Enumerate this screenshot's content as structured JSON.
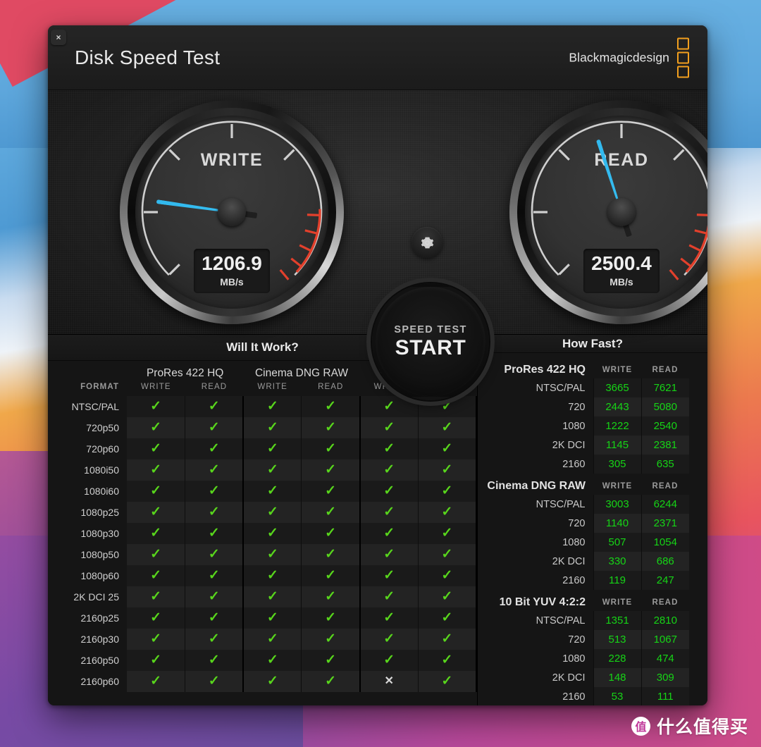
{
  "window": {
    "title": "Disk Speed Test",
    "close_label": "×",
    "brand": "Blackmagicdesign"
  },
  "gauges": {
    "write": {
      "label": "WRITE",
      "value": "1206.9",
      "unit": "MB/s",
      "needle_angle_deg": 188,
      "needle_color": "#33bbee"
    },
    "read": {
      "label": "READ",
      "value": "2500.4",
      "unit": "MB/s",
      "needle_angle_deg": 252,
      "needle_color": "#33bbee"
    }
  },
  "controls": {
    "gear_icon": "gear-icon",
    "start_sub": "SPEED TEST",
    "start_main": "START"
  },
  "will_it_work": {
    "heading": "Will It Work?",
    "format_label": "FORMAT",
    "groups": [
      "ProRes 422 HQ",
      "Cinema DNG RAW",
      "10 Bit YUV 4:2:2"
    ],
    "subheaders": [
      "WRITE",
      "READ"
    ],
    "ok_glyph": "✓",
    "no_glyph": "✕",
    "rows": [
      {
        "format": "NTSC/PAL",
        "cells": [
          true,
          true,
          true,
          true,
          true,
          true
        ]
      },
      {
        "format": "720p50",
        "cells": [
          true,
          true,
          true,
          true,
          true,
          true
        ]
      },
      {
        "format": "720p60",
        "cells": [
          true,
          true,
          true,
          true,
          true,
          true
        ]
      },
      {
        "format": "1080i50",
        "cells": [
          true,
          true,
          true,
          true,
          true,
          true
        ]
      },
      {
        "format": "1080i60",
        "cells": [
          true,
          true,
          true,
          true,
          true,
          true
        ]
      },
      {
        "format": "1080p25",
        "cells": [
          true,
          true,
          true,
          true,
          true,
          true
        ]
      },
      {
        "format": "1080p30",
        "cells": [
          true,
          true,
          true,
          true,
          true,
          true
        ]
      },
      {
        "format": "1080p50",
        "cells": [
          true,
          true,
          true,
          true,
          true,
          true
        ]
      },
      {
        "format": "1080p60",
        "cells": [
          true,
          true,
          true,
          true,
          true,
          true
        ]
      },
      {
        "format": "2K DCI 25",
        "cells": [
          true,
          true,
          true,
          true,
          true,
          true
        ]
      },
      {
        "format": "2160p25",
        "cells": [
          true,
          true,
          true,
          true,
          true,
          true
        ]
      },
      {
        "format": "2160p30",
        "cells": [
          true,
          true,
          true,
          true,
          true,
          true
        ]
      },
      {
        "format": "2160p50",
        "cells": [
          true,
          true,
          true,
          true,
          true,
          true
        ]
      },
      {
        "format": "2160p60",
        "cells": [
          true,
          true,
          true,
          true,
          false,
          true
        ]
      }
    ]
  },
  "how_fast": {
    "heading": "How Fast?",
    "col_write": "WRITE",
    "col_read": "READ",
    "sections": [
      {
        "name": "ProRes 422 HQ",
        "rows": [
          {
            "label": "NTSC/PAL",
            "write": "3665",
            "read": "7621"
          },
          {
            "label": "720",
            "write": "2443",
            "read": "5080"
          },
          {
            "label": "1080",
            "write": "1222",
            "read": "2540"
          },
          {
            "label": "2K DCI",
            "write": "1145",
            "read": "2381"
          },
          {
            "label": "2160",
            "write": "305",
            "read": "635"
          }
        ]
      },
      {
        "name": "Cinema DNG RAW",
        "rows": [
          {
            "label": "NTSC/PAL",
            "write": "3003",
            "read": "6244"
          },
          {
            "label": "720",
            "write": "1140",
            "read": "2371"
          },
          {
            "label": "1080",
            "write": "507",
            "read": "1054"
          },
          {
            "label": "2K DCI",
            "write": "330",
            "read": "686"
          },
          {
            "label": "2160",
            "write": "119",
            "read": "247"
          }
        ]
      },
      {
        "name": "10 Bit YUV 4:2:2",
        "rows": [
          {
            "label": "NTSC/PAL",
            "write": "1351",
            "read": "2810"
          },
          {
            "label": "720",
            "write": "513",
            "read": "1067"
          },
          {
            "label": "1080",
            "write": "228",
            "read": "474"
          },
          {
            "label": "2K DCI",
            "write": "148",
            "read": "309"
          },
          {
            "label": "2160",
            "write": "53",
            "read": "111"
          }
        ]
      }
    ]
  },
  "watermark": {
    "logo_char": "值",
    "text": "什么值得买"
  },
  "colors": {
    "accent_green": "#16d416",
    "check_green": "#58d51c",
    "needle_blue": "#33bbee",
    "brand_orange": "#f29f1e",
    "redzone": "#e2402c"
  }
}
